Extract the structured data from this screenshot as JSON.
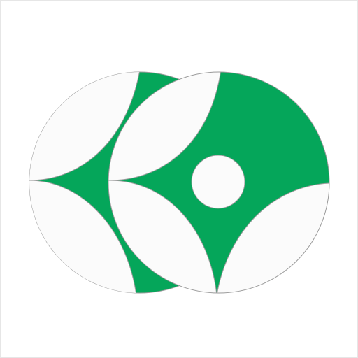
{
  "logo": {
    "name": "twin-disc-emblem",
    "colors": {
      "primary_green": "#05A65A",
      "petal_fill": "#FBFBFB",
      "outline": "#9A9A9A",
      "background": "#FFFFFF"
    }
  }
}
